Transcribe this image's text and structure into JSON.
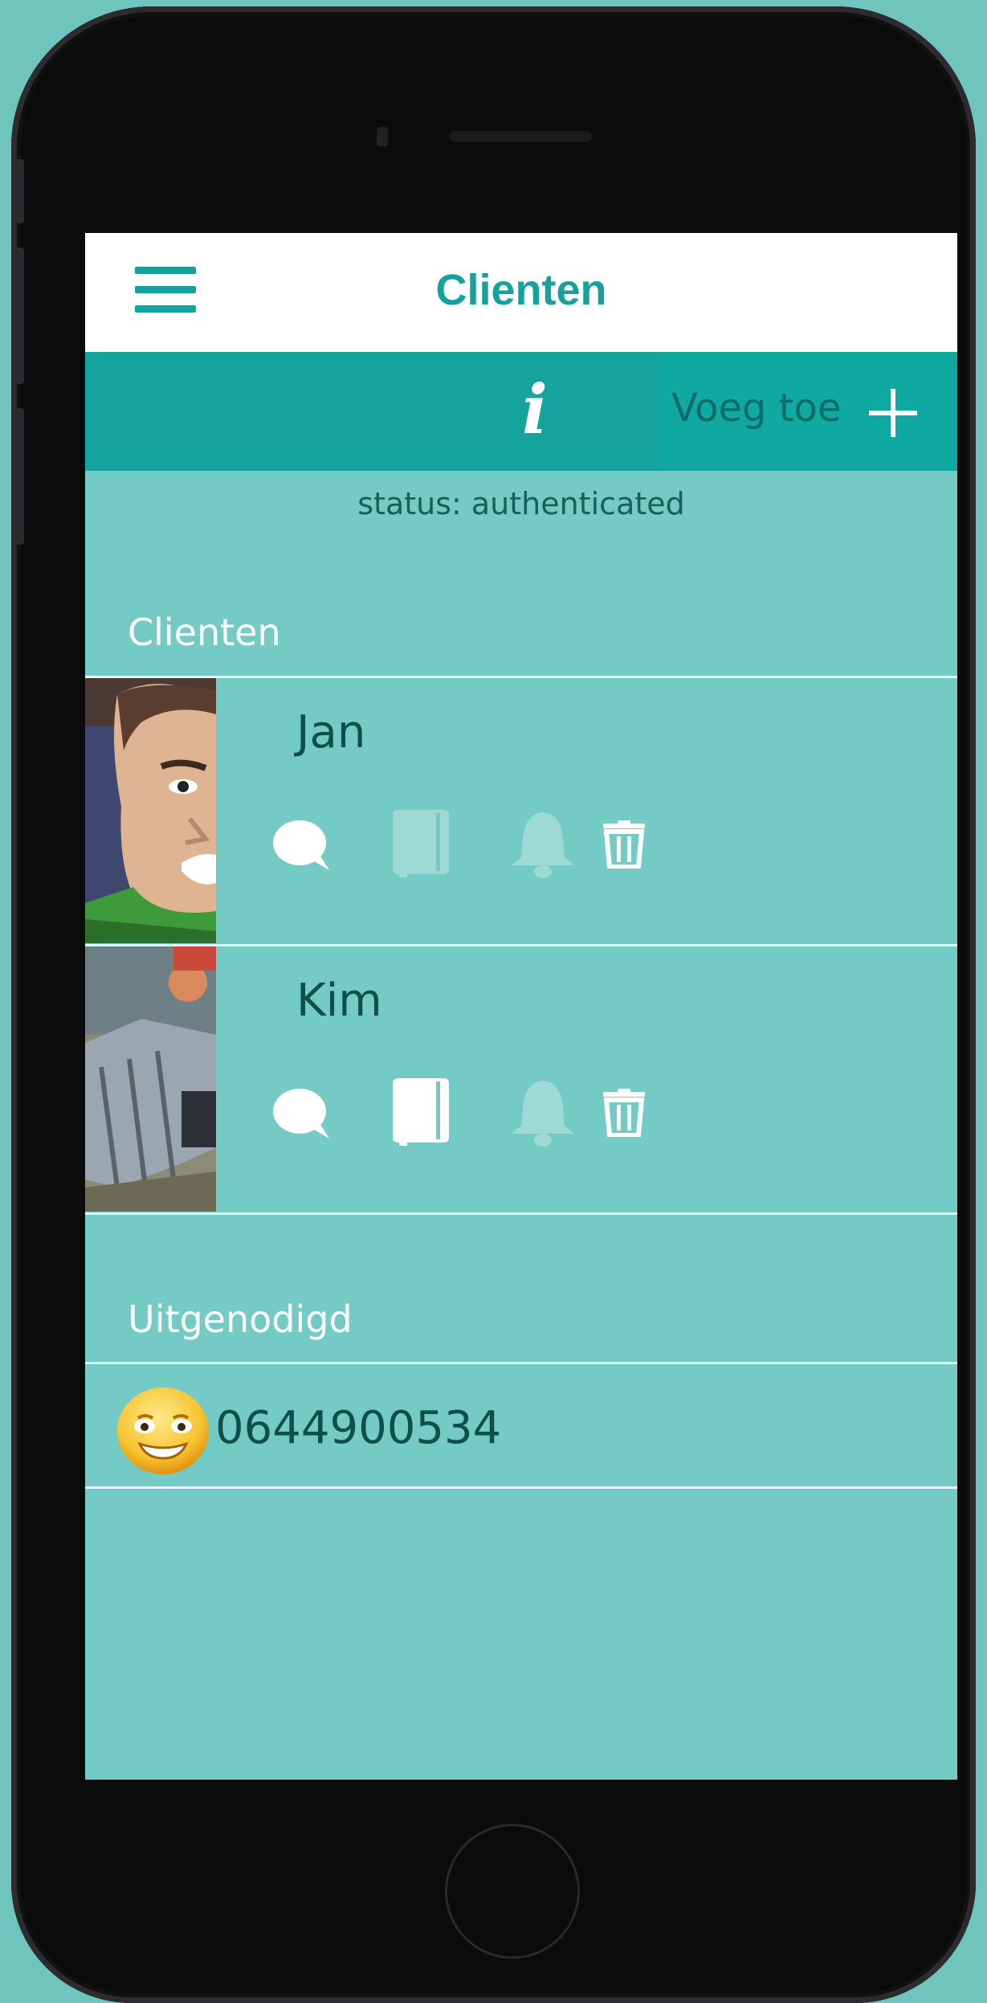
{
  "header": {
    "title": "Clienten"
  },
  "actions": {
    "add_label": "Voeg toe"
  },
  "status": {
    "text": "status: authenticated"
  },
  "clients_section": {
    "heading": "Clienten",
    "clients": [
      {
        "name": "Jan",
        "chat_enabled": true,
        "notebook_enabled": false,
        "bell_enabled": false
      },
      {
        "name": "Kim",
        "chat_enabled": true,
        "notebook_enabled": true,
        "bell_enabled": false
      }
    ]
  },
  "invited_section": {
    "heading": "Uitgenodigd",
    "items": [
      {
        "phone": "0644900534"
      }
    ]
  },
  "colors": {
    "accent": "#17a19c",
    "background": "#74cbc6",
    "icon_active": "#ffffff",
    "icon_inactive": "#9dd9d5"
  }
}
